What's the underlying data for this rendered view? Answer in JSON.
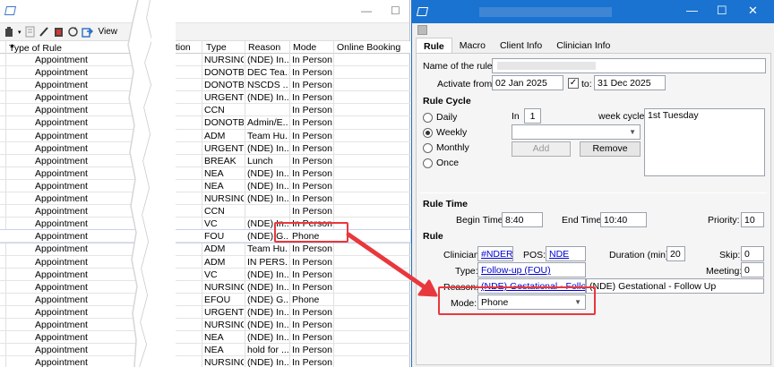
{
  "left_window": {
    "toolbar": {
      "view_label": "View"
    },
    "columns": [
      "Type of Rule",
      "N",
      "ation",
      "Type",
      "Reason",
      "Mode",
      "Online Booking"
    ],
    "rows": [
      {
        "type": "Appointment",
        "appt": "NURSING",
        "reason": "(NDE) In...",
        "mode": "In Person"
      },
      {
        "type": "Appointment",
        "appt": "DONOTB...",
        "reason": "DEC Tea...",
        "mode": "In Person"
      },
      {
        "type": "Appointment",
        "appt": "DONOTB...",
        "reason": "NSCDS ...",
        "mode": "In Person"
      },
      {
        "type": "Appointment",
        "appt": "URGENT",
        "reason": "(NDE) In...",
        "mode": "In Person"
      },
      {
        "type": "Appointment",
        "appt": "CCN",
        "reason": "",
        "mode": "In Person"
      },
      {
        "type": "Appointment",
        "appt": "DONOTB...",
        "reason": "Admin/E...",
        "mode": "In Person"
      },
      {
        "type": "Appointment",
        "appt": "ADM",
        "reason": "Team Hu...",
        "mode": "In Person"
      },
      {
        "type": "Appointment",
        "appt": "URGENT",
        "reason": "(NDE) In...",
        "mode": "In Person"
      },
      {
        "type": "Appointment",
        "appt": "BREAK",
        "reason": "Lunch",
        "mode": "In Person"
      },
      {
        "type": "Appointment",
        "appt": "NEA",
        "reason": "(NDE) In...",
        "mode": "In Person"
      },
      {
        "type": "Appointment",
        "appt": "NEA",
        "reason": "(NDE) In...",
        "mode": "In Person"
      },
      {
        "type": "Appointment",
        "appt": "NURSING",
        "reason": "(NDE) In...",
        "mode": "In Person"
      },
      {
        "type": "Appointment",
        "appt": "CCN",
        "reason": "",
        "mode": "In Person"
      },
      {
        "type": "Appointment",
        "appt": "VC",
        "reason": "(NDE) In...",
        "mode": "In Person"
      },
      {
        "type": "Appointment",
        "appt": "FOU",
        "reason": "(NDE) G...",
        "mode": "Phone"
      },
      {
        "type": "Appointment",
        "appt": "ADM",
        "reason": "Team Hu...",
        "mode": "In Person"
      },
      {
        "type": "Appointment",
        "appt": "ADM",
        "reason": "IN PERS...",
        "mode": "In Person"
      },
      {
        "type": "Appointment",
        "appt": "VC",
        "reason": "(NDE) In...",
        "mode": "In Person"
      },
      {
        "type": "Appointment",
        "appt": "NURSING",
        "reason": "(NDE) In...",
        "mode": "In Person"
      },
      {
        "type": "Appointment",
        "appt": "EFOU",
        "reason": "(NDE) G...",
        "mode": "Phone"
      },
      {
        "type": "Appointment",
        "appt": "URGENT",
        "reason": "(NDE) In...",
        "mode": "In Person"
      },
      {
        "type": "Appointment",
        "appt": "NURSING",
        "reason": "(NDE) In...",
        "mode": "In Person"
      },
      {
        "type": "Appointment",
        "appt": "NEA",
        "reason": "(NDE) In...",
        "mode": "In Person"
      },
      {
        "type": "Appointment",
        "appt": "NEA",
        "reason": "hold for ...",
        "mode": "In Person"
      },
      {
        "type": "Appointment",
        "appt": "NURSING",
        "reason": "(NDE) In...",
        "mode": "In Person"
      }
    ],
    "selected_row_index": 14
  },
  "dialog": {
    "tabs": [
      "Rule",
      "Macro",
      "Client Info",
      "Clinician Info"
    ],
    "name_label": "Name of the rule:",
    "name_value": "",
    "activate_from_label": "Activate from:",
    "activate_from_value": "02 Jan 2025",
    "to_checked": "✓",
    "to_label": "to:",
    "to_value": "31 Dec 2025",
    "rule_cycle_heading": "Rule Cycle",
    "cycle_options": [
      "Daily",
      "Weekly",
      "Monthly",
      "Once"
    ],
    "cycle_selected": "Weekly",
    "in_label": "In",
    "in_value": "1",
    "week_cycle_label": "week cycle:",
    "week_cycle_items": [
      "1st Tuesday"
    ],
    "add_label": "Add",
    "remove_label": "Remove",
    "rule_time_heading": "Rule Time",
    "begin_label": "Begin Time:",
    "begin_value": "8:40",
    "end_label": "End Time:",
    "end_value": "10:40",
    "priority_label": "Priority:",
    "priority_value": "10",
    "rule_heading": "Rule",
    "clinician_label": "Clinician:",
    "clinician_value": "#NDERN",
    "pos_label": "POS:",
    "pos_value": "NDE",
    "duration_label": "Duration (min):",
    "duration_value": "20",
    "skip_label": "Skip:",
    "skip_value": "0",
    "type_label": "Type:",
    "type_value": "Follow-up (FOU)",
    "meeting_label": "Meeting:",
    "meeting_value": "0",
    "reason_label": "Reason:",
    "reason_link": "(NDE) Gestational - Follow Up",
    "reason_value": "(NDE) Gestational  - Follow Up",
    "mode_label": "Mode:",
    "mode_value": "Phone"
  },
  "colors": {
    "accent": "#1a73d0",
    "highlight": "#e8383d",
    "link": "#0000cc"
  }
}
